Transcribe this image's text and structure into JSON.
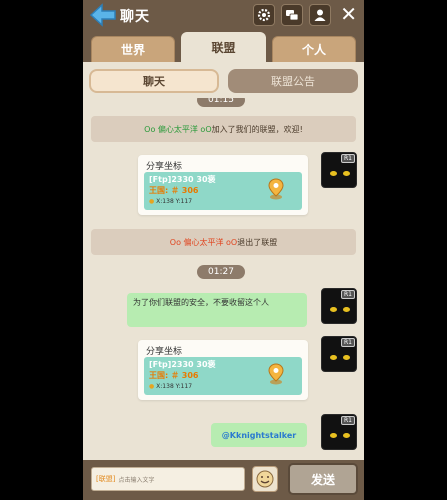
{
  "header": {
    "title": "聊天"
  },
  "tabs": [
    {
      "label": "世界",
      "active": false
    },
    {
      "label": "联盟",
      "active": true
    },
    {
      "label": "个人",
      "active": false
    }
  ],
  "subtabs": {
    "chat": "聊天",
    "notice": "联盟公告"
  },
  "messages": {
    "top_time": "01:15",
    "sys1": {
      "name": "Oo 偏心太平洋 oO",
      "text": "加入了我们的联盟，欢迎!"
    },
    "share1": {
      "title": "分享坐标",
      "line1": "[Ftp]2330 30褒",
      "line2": "王国: ＃ 306",
      "line3": "X:138 Y:117"
    },
    "sys2": {
      "name": "Oo 偏心太平洋 oO",
      "text": "退出了联盟"
    },
    "time2": "01:27",
    "msg1": "为了你们联盟的安全，不要收留这个人",
    "share2": {
      "title": "分享坐标",
      "line1": "[Ftp]2330 30褒",
      "line2": "王国: ＃ 306",
      "line3": "X:138 Y:117"
    },
    "mention": "@Kknightstalker"
  },
  "avatar_badge": "R1",
  "input": {
    "tag": "[联盟]",
    "placeholder": "点击输入文字"
  },
  "send_label": "发送",
  "colors": {
    "header": "#6d5a47",
    "panel": "#eae3d4",
    "bubble_green": "#b7ecb1",
    "share_teal": "#8fd8c8"
  }
}
